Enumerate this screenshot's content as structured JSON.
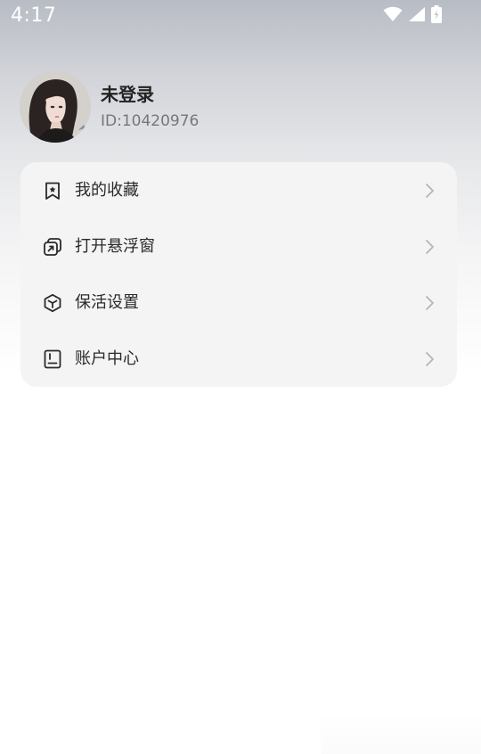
{
  "status_bar": {
    "time": "4:17",
    "icons": [
      "wifi-icon",
      "cellular-signal-icon",
      "battery-charging-icon"
    ]
  },
  "profile": {
    "name": "未登录",
    "id_text": "ID:10420976"
  },
  "menu": {
    "items": [
      {
        "label": "我的收藏",
        "icon": "bookmark-star-icon"
      },
      {
        "label": "打开悬浮窗",
        "icon": "floating-window-icon"
      },
      {
        "label": "保活设置",
        "icon": "cube-icon"
      },
      {
        "label": "账户中心",
        "icon": "account-book-icon"
      }
    ]
  },
  "colors": {
    "card_background": "#f4f4f4",
    "text_primary": "#2a2a2a",
    "text_secondary": "#777777",
    "chevron": "#b5b5b5"
  }
}
